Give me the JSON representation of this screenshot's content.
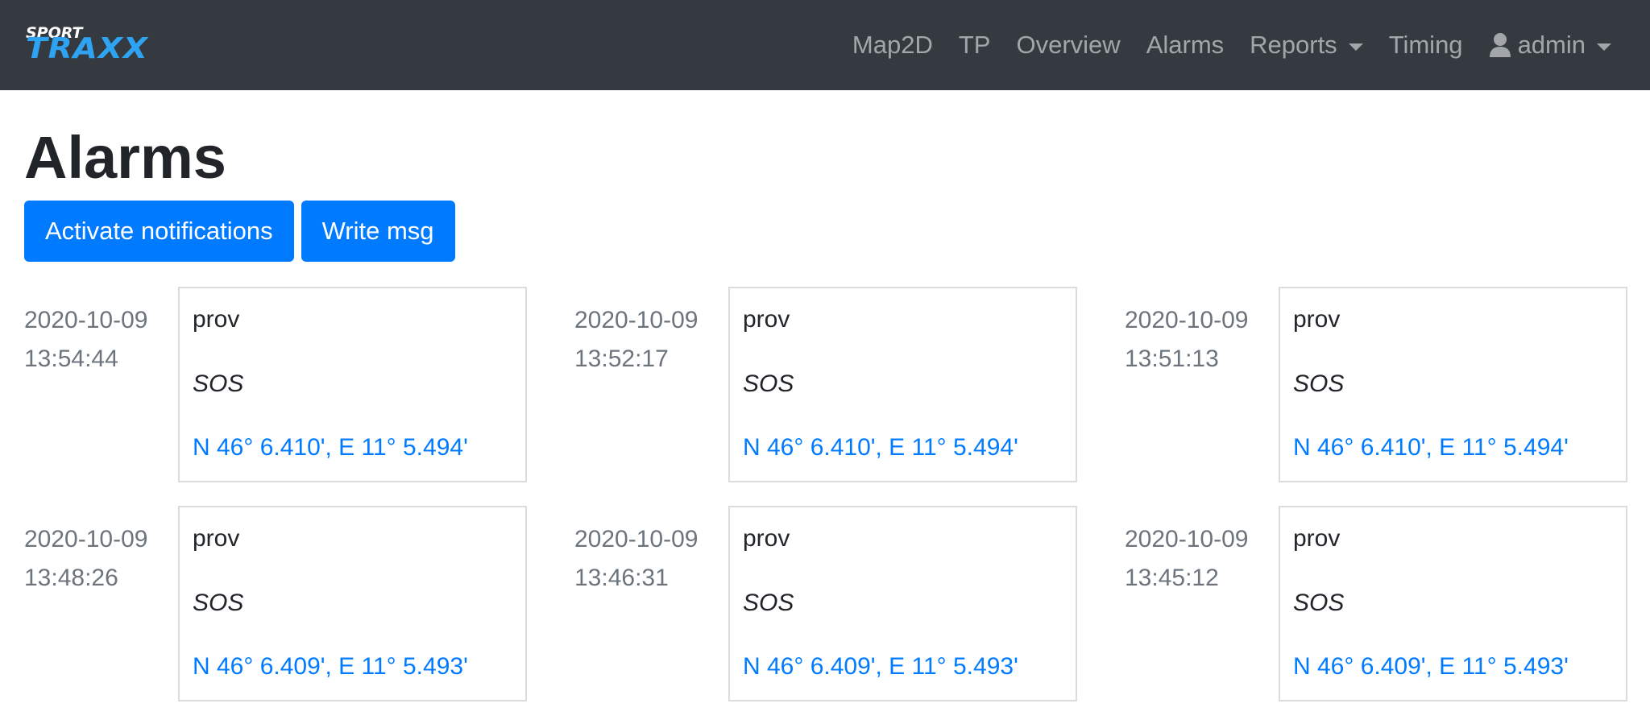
{
  "brand": {
    "top": "SPORT",
    "main": "TRAXX"
  },
  "nav": {
    "map2d": "Map2D",
    "tp": "TP",
    "overview": "Overview",
    "alarms": "Alarms",
    "reports": "Reports",
    "timing": "Timing",
    "user": "admin"
  },
  "page": {
    "title": "Alarms",
    "activate_label": "Activate notifications",
    "write_label": "Write msg"
  },
  "alarms": [
    {
      "date": "2020-10-09",
      "time": "13:54:44",
      "name": "prov",
      "type": "SOS",
      "coord": "N 46° 6.410', E 11° 5.494'"
    },
    {
      "date": "2020-10-09",
      "time": "13:52:17",
      "name": "prov",
      "type": "SOS",
      "coord": "N 46° 6.410', E 11° 5.494'"
    },
    {
      "date": "2020-10-09",
      "time": "13:51:13",
      "name": "prov",
      "type": "SOS",
      "coord": "N 46° 6.410', E 11° 5.494'"
    },
    {
      "date": "2020-10-09",
      "time": "13:48:26",
      "name": "prov",
      "type": "SOS",
      "coord": "N 46° 6.409', E 11° 5.493'"
    },
    {
      "date": "2020-10-09",
      "time": "13:46:31",
      "name": "prov",
      "type": "SOS",
      "coord": "N 46° 6.409', E 11° 5.493'"
    },
    {
      "date": "2020-10-09",
      "time": "13:45:12",
      "name": "prov",
      "type": "SOS",
      "coord": "N 46° 6.409', E 11° 5.493'"
    }
  ],
  "colors": {
    "navbar": "#343a40",
    "brand_accent": "#2ea3f2",
    "primary": "#007bff",
    "muted": "#6c757d"
  },
  "icons": {
    "user": "user-icon",
    "dropdown": "caret-down-icon"
  }
}
